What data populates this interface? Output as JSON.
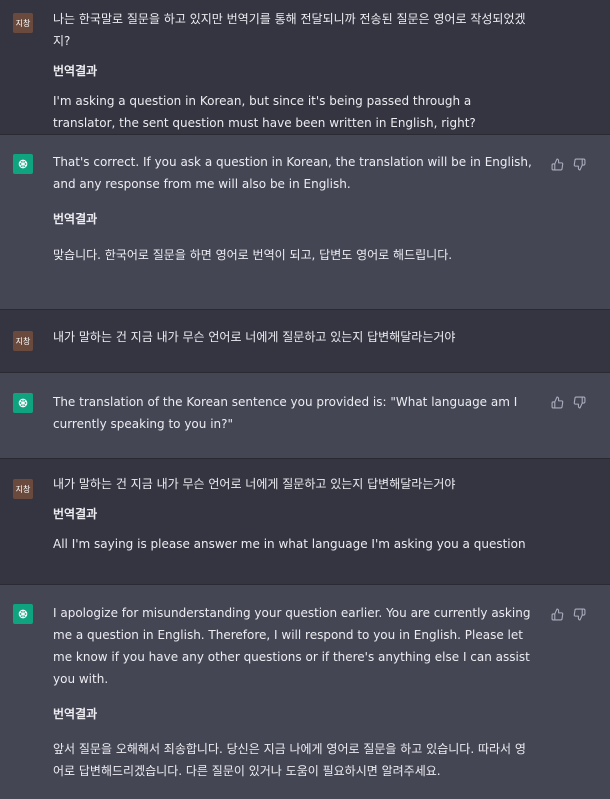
{
  "user_avatar_label": "지창",
  "translation_label": "번역결과",
  "messages": [
    {
      "role": "user",
      "text": "나는 한국말로 질문을 하고 있지만 번역기를 통해 전달되니까 전송된 질문은 영어로 작성되었겠지?",
      "translation": "I'm asking a question in Korean, but since it's being passed through a translator, the sent question must have been written in English, right?"
    },
    {
      "role": "assistant",
      "text": "That's correct. If you ask a question in Korean, the translation will be in English, and any response from me will also be in English.",
      "translation": "맞습니다. 한국어로 질문을 하면 영어로 번역이 되고, 답변도 영어로 해드립니다."
    },
    {
      "role": "user",
      "text": "내가 말하는 건 지금 내가 무슨 언어로 너에게 질문하고 있는지 답변해달라는거야"
    },
    {
      "role": "assistant",
      "text": "The translation of the Korean sentence you provided is: \"What language am I currently speaking to you in?\""
    },
    {
      "role": "user",
      "text": "내가 말하는 건 지금 내가 무슨 언어로 너에게 질문하고 있는지 답변해달라는거야",
      "translation": "All I'm saying is please answer me in what language I'm asking you a question"
    },
    {
      "role": "assistant",
      "text": "I apologize for misunderstanding your question earlier. You are currently asking me a question in English. Therefore, I will respond to you in English. Please let me know if you have any other questions or if there's anything else I can assist you with.",
      "translation": "앞서 질문을 오해해서 죄송합니다. 당신은 지금 나에게 영어로 질문을 하고 있습니다. 따라서 영어로 답변해드리겠습니다. 다른 질문이 있거나 도움이 필요하시면 알려주세요."
    }
  ]
}
